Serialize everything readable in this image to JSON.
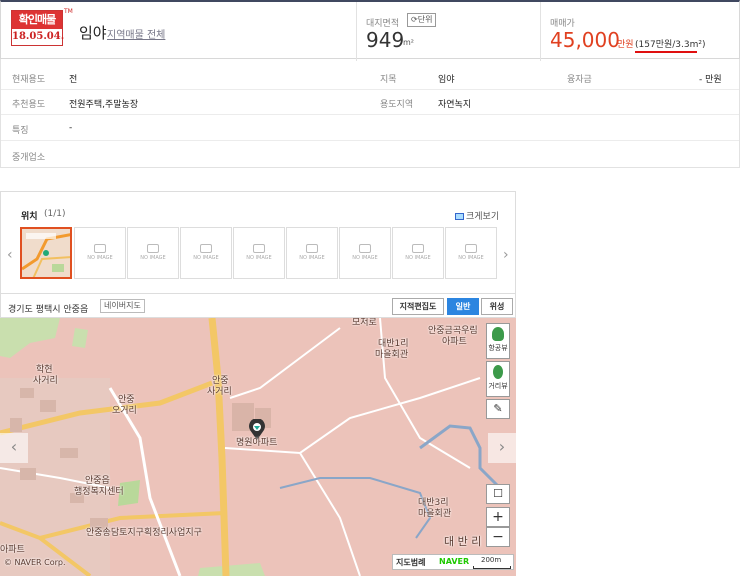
{
  "header": {
    "badge_title": "확인매물",
    "badge_date": "18.05.04.",
    "badge_tm": "TM",
    "title": "임야",
    "title_link": "지역매물 전체",
    "area_label": "대지면적",
    "unit_button": "단위",
    "area_value": "949",
    "area_unit": "m²",
    "price_label": "매매가",
    "price_value": "45,000",
    "price_unit": "만원",
    "price_sub": "(157만원/3.3m²)"
  },
  "info": {
    "rows": [
      {
        "l1": "현재용도",
        "v1": "전",
        "l2": "지목",
        "v2": "임야",
        "l3": "융자금",
        "v3": "- 만원"
      },
      {
        "l1": "추천용도",
        "v1": "전원주택,주말농장",
        "l2": "용도지역",
        "v2": "자연녹지"
      },
      {
        "l1": "특징",
        "v1": "-"
      },
      {
        "l1": "중개업소"
      }
    ]
  },
  "gallery": {
    "title": "위치",
    "count": "(1/1)",
    "enlarge": "크게보기",
    "no_image": "NO IMAGE",
    "prev": "‹",
    "next": "›"
  },
  "map": {
    "address": "경기도 평택시 안중읍",
    "naver_map_button": "네이버지도",
    "tabs": [
      "지적편집도",
      "일반",
      "위성"
    ],
    "active_tab": "일반",
    "labels": {
      "aptA": "안중금곡우림",
      "aptA2": "아파트",
      "hall1": "대반1리",
      "hall1b": "마을회관",
      "hall3": "대반3리",
      "hall3b": "마을회관",
      "hakhyeon": "학현",
      "hakhyeon2": "사거리",
      "anjung5": "안중",
      "anjung5b": "오거리",
      "anjung4": "안중",
      "anjung4b": "사거리",
      "myeongwon": "명원아파트",
      "welfare": "안중읍",
      "welfare2": "행정복지센터",
      "project": "안중송담토지구획정리사업지구",
      "daebanri": "대 반 리",
      "copyright": "© NAVER Corp.",
      "corner": "아파트",
      "road": "모저로"
    },
    "ctrl_street": "항공뷰",
    "ctrl_distance": "거리뷰",
    "zoom_in": "+",
    "zoom_out": "−",
    "legend": "지도범례",
    "naver": "NAVER",
    "scale": "200m"
  }
}
